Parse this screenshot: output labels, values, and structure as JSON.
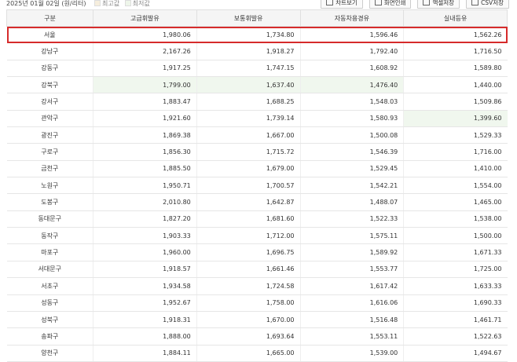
{
  "header": {
    "date_unit": "2025년 01월 02일 (원/리터)",
    "legend_max_label": "최고값",
    "legend_min_label": "최저값",
    "buttons": [
      "차트보기",
      "화면인쇄",
      "액셀저장",
      "CSV저장"
    ]
  },
  "table": {
    "columns": [
      "구분",
      "고급휘발유",
      "보통휘발유",
      "자동차용경유",
      "실내등유"
    ],
    "rows": [
      [
        "서울",
        "1,980.06",
        "1,734.80",
        "1,596.46",
        "1,562.26"
      ],
      [
        "강남구",
        "2,167.26",
        "1,918.27",
        "1,792.40",
        "1,716.50"
      ],
      [
        "강동구",
        "1,917.25",
        "1,747.15",
        "1,608.92",
        "1,589.80"
      ],
      [
        "강북구",
        "1,799.00",
        "1,637.40",
        "1,476.40",
        "1,440.00"
      ],
      [
        "강서구",
        "1,883.47",
        "1,688.25",
        "1,548.03",
        "1,509.86"
      ],
      [
        "관악구",
        "1,921.60",
        "1,739.14",
        "1,580.93",
        "1,399.60"
      ],
      [
        "광진구",
        "1,869.38",
        "1,667.00",
        "1,500.08",
        "1,529.33"
      ],
      [
        "구로구",
        "1,856.30",
        "1,715.72",
        "1,546.39",
        "1,716.00"
      ],
      [
        "금천구",
        "1,885.50",
        "1,679.00",
        "1,529.45",
        "1,410.00"
      ],
      [
        "노원구",
        "1,950.71",
        "1,700.57",
        "1,542.21",
        "1,554.00"
      ],
      [
        "도봉구",
        "2,010.80",
        "1,642.87",
        "1,488.07",
        "1,465.00"
      ],
      [
        "동대문구",
        "1,827.20",
        "1,681.60",
        "1,522.33",
        "1,538.00"
      ],
      [
        "동작구",
        "1,903.33",
        "1,712.00",
        "1,575.11",
        "1,500.00"
      ],
      [
        "마포구",
        "1,960.00",
        "1,696.75",
        "1,589.92",
        "1,671.33"
      ],
      [
        "서대문구",
        "1,918.57",
        "1,661.46",
        "1,553.77",
        "1,725.00"
      ],
      [
        "서초구",
        "1,934.58",
        "1,724.58",
        "1,617.42",
        "1,633.33"
      ],
      [
        "성동구",
        "1,952.67",
        "1,758.00",
        "1,616.06",
        "1,690.33"
      ],
      [
        "성북구",
        "1,918.31",
        "1,670.00",
        "1,516.48",
        "1,461.71"
      ],
      [
        "송파구",
        "1,888.00",
        "1,693.64",
        "1,553.11",
        "1,522.63"
      ],
      [
        "양천구",
        "1,884.11",
        "1,665.00",
        "1,539.00",
        "1,494.67"
      ]
    ],
    "min_cells": [
      [
        3,
        1
      ],
      [
        3,
        2
      ],
      [
        3,
        3
      ],
      [
        5,
        4
      ]
    ],
    "colors": {
      "highlight_border": "#d62b2b",
      "min_bg": "#f0f7ee"
    }
  }
}
